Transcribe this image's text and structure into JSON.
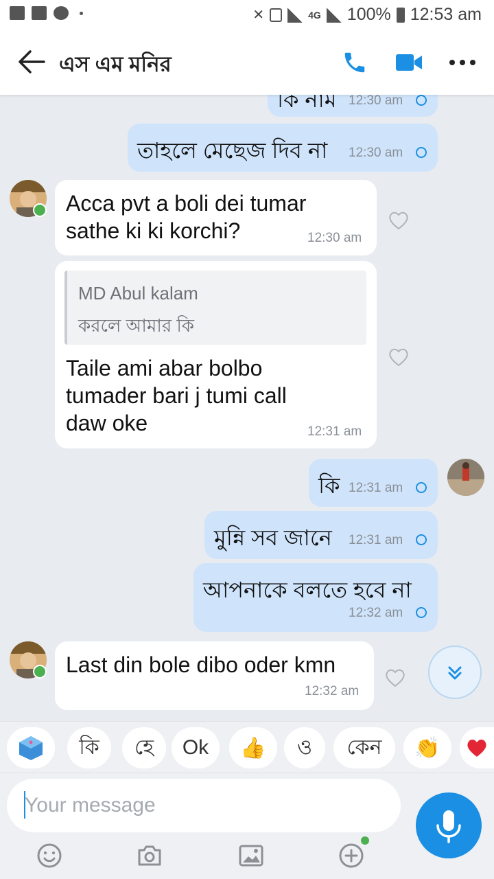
{
  "status_bar": {
    "network": "4G",
    "battery": "100%",
    "time": "12:53 am"
  },
  "header": {
    "title": "এস এম মনির"
  },
  "messages": [
    {
      "direction": "out",
      "text": "কি নাম",
      "time": "12:30 am",
      "seen": true
    },
    {
      "direction": "out",
      "text": "তাহলে মেছেজ দিব না",
      "time": "12:30 am",
      "seen": true
    },
    {
      "direction": "in",
      "lines": [
        "Acca pvt a boli dei tumar",
        "sathe ki ki korchi?"
      ],
      "time": "12:30 am"
    },
    {
      "direction": "in",
      "quote": {
        "author": "MD Abul kalam",
        "text": "করলে আমার কি"
      },
      "lines": [
        "Taile ami abar bolbo",
        "tumader bari j tumi call",
        "daw oke"
      ],
      "time": "12:31 am"
    },
    {
      "direction": "out",
      "text": "কি",
      "time": "12:31 am",
      "seen": true
    },
    {
      "direction": "out",
      "text": "মুন্নি সব জানে",
      "time": "12:31 am",
      "seen": true
    },
    {
      "direction": "out",
      "text": "আপনাকে বলতে হবে না",
      "time": "12:32 am",
      "seen": true
    },
    {
      "direction": "in",
      "text": "Last din bole dibo oder kmn",
      "time": "12:32 am"
    }
  ],
  "quick_replies": [
    "কি",
    "হে",
    "Ok",
    "ও",
    "কেন"
  ],
  "composer": {
    "placeholder": "Your message"
  },
  "colors": {
    "accent": "#1a8fe3",
    "outgoing_bubble": "#cfe4fb",
    "incoming_bubble": "#ffffff",
    "background": "#e8ebef",
    "online": "#4caf50"
  }
}
